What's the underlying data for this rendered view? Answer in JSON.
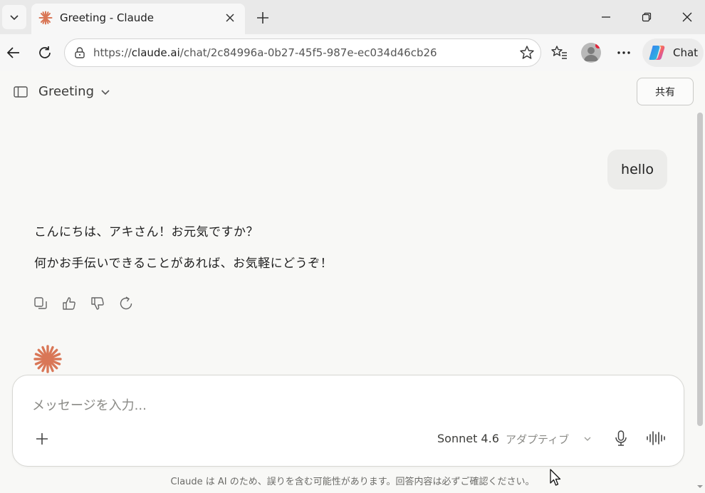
{
  "browser": {
    "tab": {
      "title": "Greeting - Claude"
    },
    "address": {
      "scheme": "https://",
      "host": "claude.ai",
      "path": "/chat/2c84996a-0b27-45f5-987e-ec034d46cb26"
    },
    "copilot_label": "Chat"
  },
  "header": {
    "conversation_title": "Greeting",
    "share_label": "共有"
  },
  "messages": {
    "user": "hello",
    "assistant": [
      "こんにちは、アキさん！お元気ですか？",
      "何かお手伝いできることがあれば、お気軽にどうぞ！"
    ]
  },
  "composer": {
    "placeholder": "メッセージを入力...",
    "model": "Sonnet 4.6",
    "mode": "アダプティブ"
  },
  "footer": {
    "disclaimer": "Claude は AI のため、誤りを含む可能性があります。回答内容は必ずご確認ください。"
  },
  "colors": {
    "accent": "#d97757",
    "background": "#f8f8f6",
    "composer_bg": "#ffffff",
    "user_bubble": "#ececea"
  }
}
